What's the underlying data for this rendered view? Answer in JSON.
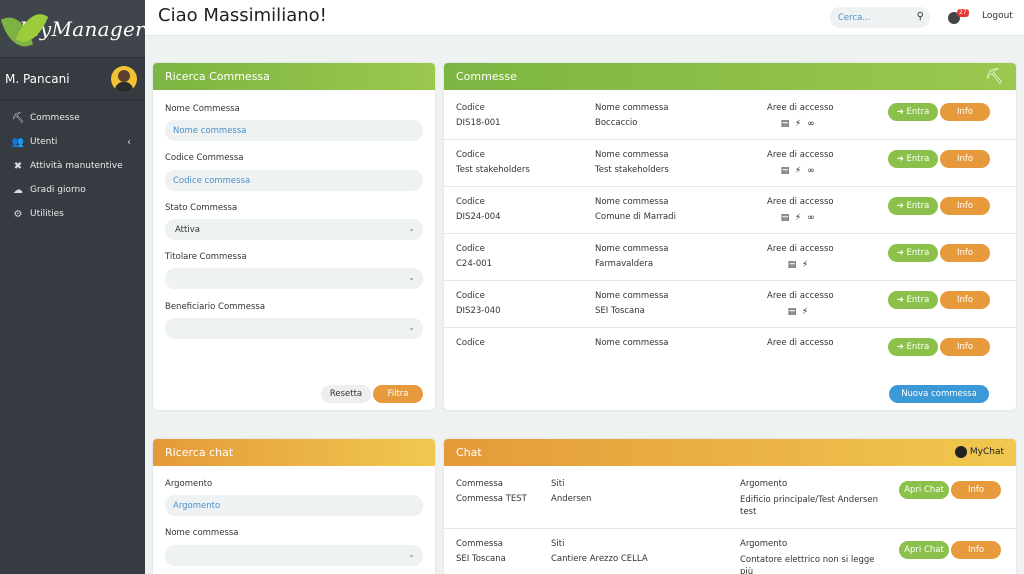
{
  "brand": {
    "name": "MyManager"
  },
  "user": {
    "name": "M. Pancani"
  },
  "sidebar": {
    "items": [
      {
        "label": "Commesse",
        "icon": "compass-icon",
        "glyph": "⛏"
      },
      {
        "label": "Utenti",
        "icon": "users-icon",
        "glyph": "👥"
      },
      {
        "label": "Attività manutentive",
        "icon": "tools-icon",
        "glyph": "✖"
      },
      {
        "label": "Gradi giorno",
        "icon": "cloud-sun-icon",
        "glyph": "☁"
      },
      {
        "label": "Utilities",
        "icon": "gear-icon",
        "glyph": "⚙"
      }
    ],
    "utenti_caret": "‹"
  },
  "header": {
    "greeting": "Ciao Massimiliano!",
    "search_placeholder": "Cerca...",
    "notification_count": "27",
    "logout": "Logout"
  },
  "ricerca_commessa": {
    "title": "Ricerca Commessa",
    "nome_label": "Nome Commessa",
    "nome_placeholder": "Nome commessa",
    "codice_label": "Codice Commessa",
    "codice_placeholder": "Codice commessa",
    "stato_label": "Stato Commessa",
    "stato_value": "Attiva",
    "titolare_label": "Titolare Commessa",
    "titolare_value": "",
    "beneficiario_label": "Beneficiario Commessa",
    "beneficiario_value": "",
    "reset": "Resetta",
    "filter": "Filtra"
  },
  "commesse": {
    "title": "Commesse",
    "col_codice": "Codice",
    "col_nome": "Nome commessa",
    "col_aree": "Aree di accesso",
    "enter": "➜ Entra",
    "info": "Info",
    "new": "Nuova commessa",
    "rows": [
      {
        "codice": "DIS18-001",
        "nome": "Boccaccio",
        "aree": [
          "doc",
          "plug",
          "link"
        ]
      },
      {
        "codice": "Test stakeholders",
        "nome": "Test stakeholders",
        "aree": [
          "doc",
          "plug",
          "link"
        ]
      },
      {
        "codice": "DIS24-004",
        "nome": "Comune di Marradi",
        "aree": [
          "doc",
          "plug",
          "link"
        ]
      },
      {
        "codice": "C24-001",
        "nome": "Farmavaldera",
        "aree": [
          "doc",
          "plug"
        ]
      },
      {
        "codice": "DIS23-040",
        "nome": "SEI Toscana",
        "aree": [
          "doc",
          "plug"
        ]
      },
      {
        "codice": "",
        "nome": "",
        "aree": []
      }
    ]
  },
  "ricerca_chat": {
    "title": "Ricerca chat",
    "argomento_label": "Argomento",
    "argomento_placeholder": "Argomento",
    "nome_label": "Nome commessa",
    "nome_value": ""
  },
  "chat": {
    "title": "Chat",
    "brand": "MyChat",
    "col_commessa": "Commessa",
    "col_siti": "Siti",
    "col_argomento": "Argomento",
    "open": "Apri Chat",
    "info": "Info",
    "rows": [
      {
        "commessa": "Commessa TEST",
        "siti": "Andersen",
        "argomento": "Edificio principale/Test Andersen test"
      },
      {
        "commessa": "SEI Toscana",
        "siti": "Cantiere Arezzo CELLA",
        "argomento": "Contatore elettrico non si legge più"
      }
    ]
  },
  "colors": {
    "sidebar": "#353b41",
    "green": "#8bc14a",
    "orange": "#e69a3c",
    "blue": "#3c99d8",
    "link": "#4a90c8"
  }
}
